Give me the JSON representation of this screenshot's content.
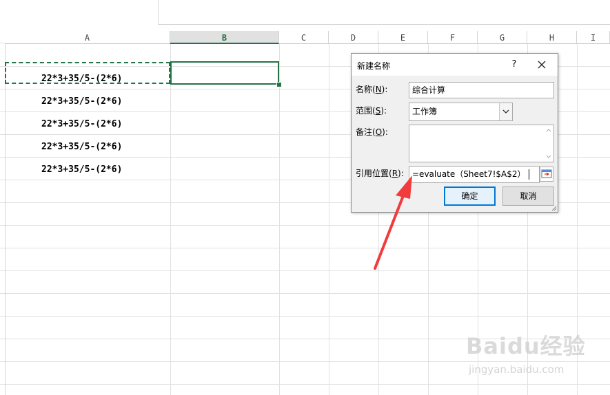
{
  "sheet": {
    "columns": [
      {
        "label": "A"
      },
      {
        "label": "B"
      },
      {
        "label": "C"
      },
      {
        "label": "D"
      },
      {
        "label": "E"
      },
      {
        "label": "F"
      },
      {
        "label": "G"
      },
      {
        "label": "H"
      },
      {
        "label": "I"
      }
    ],
    "selected_column": "B",
    "cells": [
      "22*3+35/5-(2*6)",
      "22*3+35/5-(2*6)",
      "22*3+35/5-(2*6)",
      "22*3+35/5-(2*6)",
      "22*3+35/5-(2*6)"
    ],
    "accent_color": "#217346"
  },
  "dialog": {
    "title": "新建名称",
    "help": "?",
    "name_label_pre": "名称(",
    "name_label_key": "N",
    "name_label_post": "):",
    "name_value": "综合计算",
    "scope_label_pre": "范围(",
    "scope_label_key": "S",
    "scope_label_post": "):",
    "scope_value": "工作簿",
    "comment_label_pre": "备注(",
    "comment_label_key": "O",
    "comment_label_post": "):",
    "comment_value": "",
    "ref_label_pre": "引用位置(",
    "ref_label_key": "R",
    "ref_label_post": "):",
    "ref_value": "=evaluate（Sheet7!$A$2）",
    "ok_label": "确定",
    "cancel_label": "取消"
  },
  "annotation": {
    "arrow_color": "#f03c3c"
  },
  "watermark": {
    "brand": "Baidu经验",
    "url": "jingyan.baidu.com"
  }
}
